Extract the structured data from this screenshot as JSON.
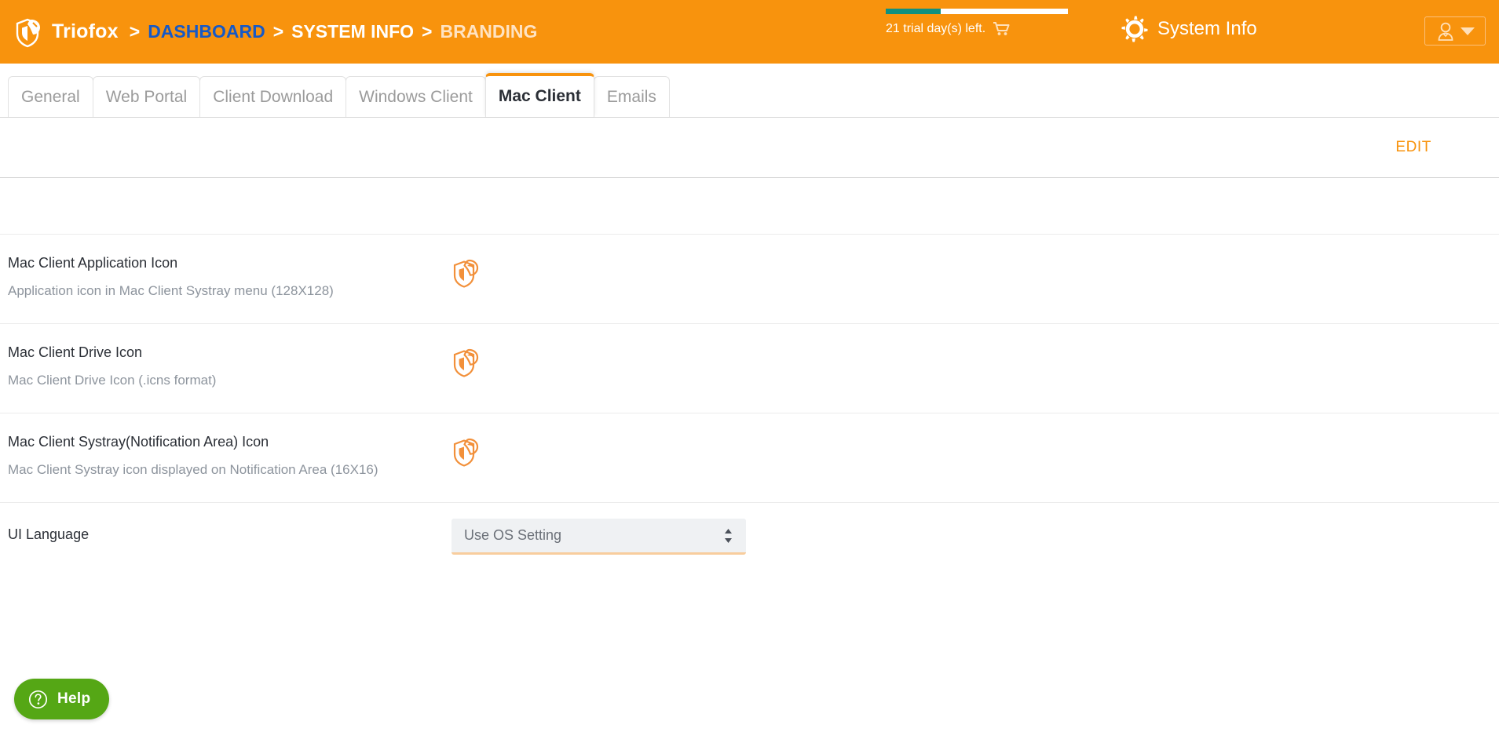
{
  "header": {
    "brand_name": "Triofox",
    "logo_icon": "shield-logo-icon",
    "breadcrumbs": [
      {
        "label": "DASHBOARD",
        "style": "link"
      },
      {
        "label": "SYSTEM INFO",
        "style": "plain"
      },
      {
        "label": "BRANDING",
        "style": "dim"
      }
    ],
    "separator": ">",
    "trial": {
      "text": "21 trial day(s) left.",
      "cart_icon": "shopping-cart-icon",
      "progress_percent": 30,
      "bar_fill_color": "#0f9080",
      "bar_track_color": "#ffffff"
    },
    "system_info": {
      "label": "System Info",
      "icon": "gear-icon"
    },
    "user_menu": {
      "icon": "user-avatar-icon",
      "caret": "chevron-down-icon"
    },
    "background_color": "#f8930d"
  },
  "tabs": [
    {
      "label": "General",
      "active": false
    },
    {
      "label": "Web Portal",
      "active": false
    },
    {
      "label": "Client Download",
      "active": false
    },
    {
      "label": "Windows Client",
      "active": false
    },
    {
      "label": "Mac Client",
      "active": true
    },
    {
      "label": "Emails",
      "active": false
    }
  ],
  "actionbar": {
    "edit_label": "EDIT",
    "accent_color": "#f8930d"
  },
  "rows": [
    {
      "title": "Mac Client Application Icon",
      "desc": "Application icon in Mac Client Systray menu (128X128)",
      "value_icon": "triofox-shield-icon"
    },
    {
      "title": "Mac Client Drive Icon",
      "desc": "Mac Client Drive Icon (.icns format)",
      "value_icon": "triofox-shield-icon"
    },
    {
      "title": "Mac Client Systray(Notification Area) Icon",
      "desc": "Mac Client Systray icon displayed on Notification Area (16X16)",
      "value_icon": "triofox-shield-icon"
    }
  ],
  "language_row": {
    "label": "UI Language",
    "selected": "Use OS Setting",
    "options": [
      "Use OS Setting"
    ],
    "arrows_icon": "sort-updown-icon",
    "underline_color": "#f8cd9d"
  },
  "help": {
    "label": "Help",
    "icon": "question-circle-icon",
    "color": "#55a715"
  }
}
